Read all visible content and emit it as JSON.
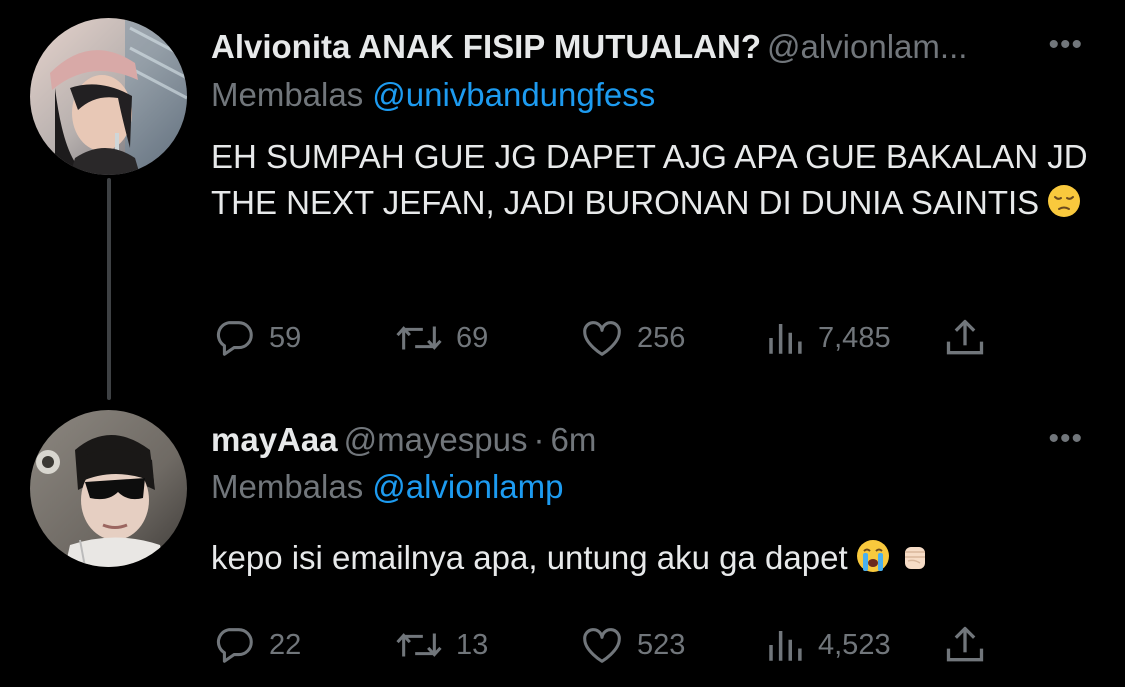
{
  "colors": {
    "background": "#000000",
    "text_primary": "#e7e9ea",
    "text_secondary": "#71767b",
    "link": "#1d9bf0",
    "thread_line": "#3e4144"
  },
  "tweets": [
    {
      "display_name": "Alvionita ANAK FISIP MUTUALAN?",
      "handle": "@alvionlam...",
      "time": "",
      "reply_prefix": "Membalas",
      "reply_to": "@univbandungfess",
      "text": "EH SUMPAH GUE JG DAPET AJG APA GUE BAKALAN JD THE NEXT JEFAN, JADI BURONAN DI DUNIA SAINTIS",
      "emojis": [
        "pensive-face-emoji"
      ],
      "more_label": "•••",
      "stats": {
        "replies": "59",
        "retweets": "69",
        "likes": "256",
        "views": "7,485"
      }
    },
    {
      "display_name": "mayAaa",
      "handle": "@mayespus",
      "separator": "·",
      "time": "6m",
      "reply_prefix": "Membalas",
      "reply_to": "@alvionlamp",
      "text": "kepo isi emailnya apa, untung aku ga dapet",
      "emojis": [
        "loudly-crying-face-emoji",
        "raised-fist-emoji"
      ],
      "more_label": "•••",
      "stats": {
        "replies": "22",
        "retweets": "13",
        "likes": "523",
        "views": "4,523"
      }
    }
  ],
  "icons": [
    "reply-icon",
    "retweet-icon",
    "like-icon",
    "views-icon",
    "share-icon",
    "more-icon"
  ]
}
